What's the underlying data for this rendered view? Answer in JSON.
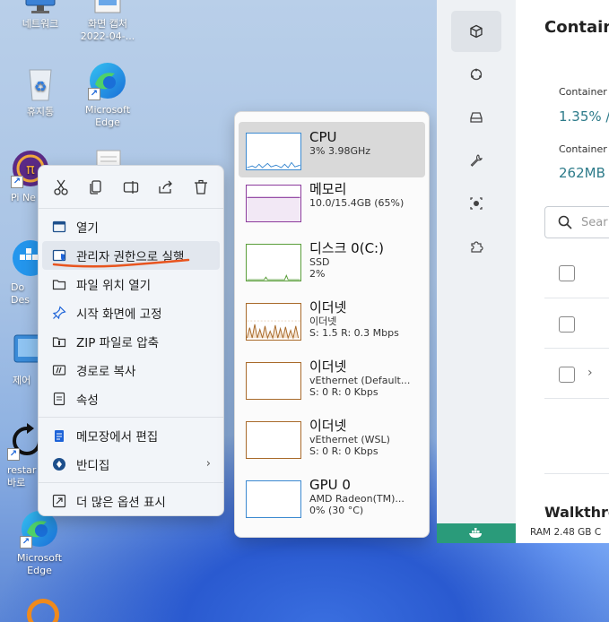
{
  "desktop": {
    "icons": [
      {
        "label": "네트워크"
      },
      {
        "label": "화면 캡처"
      },
      {
        "label": "2022-04-..."
      },
      {
        "label": "휴지통"
      },
      {
        "label": "Microsoft"
      },
      {
        "label": "Edge"
      },
      {
        "label": "Pi Ne"
      },
      {
        "label": "Do"
      },
      {
        "label": "Des"
      },
      {
        "label": "제어"
      },
      {
        "label": "restar"
      },
      {
        "label": "바로"
      },
      {
        "label": "Microsoft"
      },
      {
        "label": "Edge"
      }
    ]
  },
  "context_menu": {
    "toolbar": [
      {
        "icon": "cut-icon"
      },
      {
        "icon": "copy-icon"
      },
      {
        "icon": "rename-icon"
      },
      {
        "icon": "share-icon"
      },
      {
        "icon": "delete-icon"
      }
    ],
    "items": [
      {
        "label": "열기"
      },
      {
        "label": "관리자 권한으로 실행"
      },
      {
        "label": "파일 위치 열기"
      },
      {
        "label": "시작 화면에 고정"
      },
      {
        "label": "ZIP 파일로 압축"
      },
      {
        "label": "경로로 복사"
      },
      {
        "label": "속성"
      },
      {
        "label": "메모장에서 편집"
      },
      {
        "label": "반디집"
      },
      {
        "label": "더 많은 옵션 표시"
      }
    ]
  },
  "performance": {
    "items": [
      {
        "title": "CPU",
        "sub1": "3% 3.98GHz",
        "sub2": ""
      },
      {
        "title": "메모리",
        "sub1": "10.0/15.4GB (65%)",
        "sub2": ""
      },
      {
        "title": "디스크 0(C:)",
        "sub1": "SSD",
        "sub2": "2%"
      },
      {
        "title": "이더넷",
        "sub1": "이더넷",
        "sub2": "S: 1.5  R: 0.3 Mbps"
      },
      {
        "title": "이더넷",
        "sub1": "vEthernet (Default...",
        "sub2": "S: 0  R: 0 Kbps"
      },
      {
        "title": "이더넷",
        "sub1": "vEthernet (WSL)",
        "sub2": "S: 0  R: 0 Kbps"
      },
      {
        "title": "GPU 0",
        "sub1": "AMD Radeon(TM)...",
        "sub2": "0% (30 °C)"
      }
    ]
  },
  "docker": {
    "title": "Contain",
    "cpu_label": "Container",
    "cpu_value": "1.35% /",
    "mem_label": "Container",
    "mem_value": "262MB /",
    "search_placeholder": "Sear",
    "walkthrough": "Walkthro",
    "status": "RAM 2.48 GB  C"
  }
}
